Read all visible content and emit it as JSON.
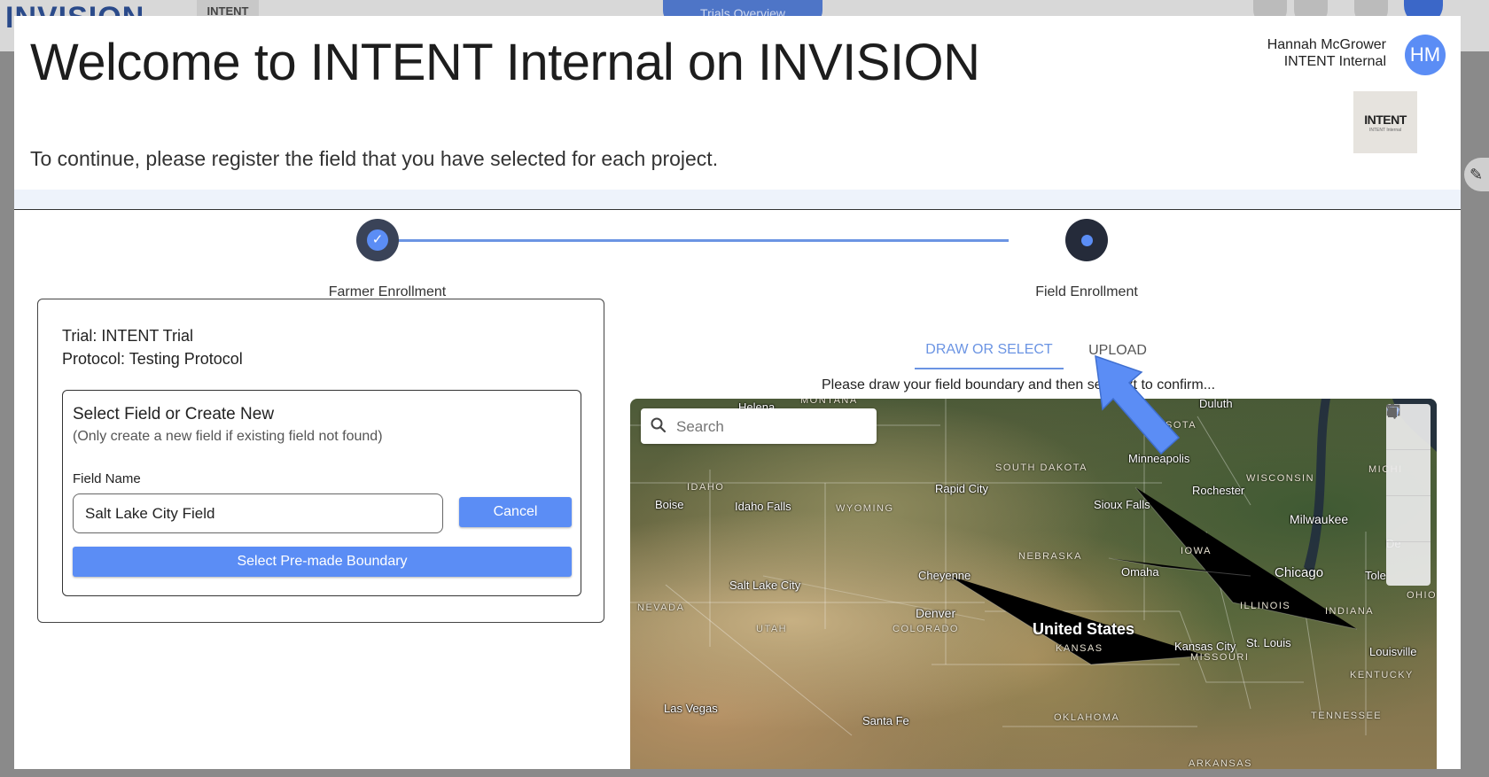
{
  "background": {
    "app_logo": "INVISION",
    "mini_tab": "INTENT",
    "pill": "Trials Overview"
  },
  "modal": {
    "title": "Welcome to INTENT Internal on INVISION",
    "subtitle": "To continue, please register the field that you have selected for each project.",
    "user": {
      "name": "Hannah McGrower",
      "org": "INTENT Internal",
      "initials": "HM"
    },
    "org_logo": {
      "name": "INTENT",
      "tagline": "INTENT Internal"
    }
  },
  "stepper": {
    "steps": [
      {
        "label": "Farmer Enrollment",
        "status": "complete"
      },
      {
        "label": "Field Enrollment",
        "status": "active"
      }
    ]
  },
  "enrollment": {
    "trial": "Trial: INTENT Trial",
    "protocol": "Protocol: Testing Protocol",
    "select_title": "Select Field or Create New",
    "select_hint": "(Only create a new field if existing field not found)",
    "field_name_label": "Field Name",
    "field_name_value": "Salt Lake City Field",
    "cancel_label": "Cancel",
    "premade_label": "Select Pre-made Boundary"
  },
  "map_panel": {
    "tabs": [
      {
        "label": "DRAW OR SELECT",
        "active": true
      },
      {
        "label": "UPLOAD",
        "active": false
      }
    ],
    "instruction": "Please draw your field boundary and then se",
    "instruction_tail": "ext to confirm...",
    "search_placeholder": "Search",
    "tools": [
      "pointer-icon",
      "rectangle-icon",
      "polygon-icon",
      "trash-icon"
    ],
    "labels": {
      "cities": [
        "Helena",
        "Duluth",
        "Minneapolis",
        "Boise",
        "Idaho Falls",
        "Rapid City",
        "Rochester",
        "Sioux Falls",
        "Milwaukee",
        "De",
        "Omaha",
        "Chicago",
        "Tole",
        "Salt Lake City",
        "Cheyenne",
        "Denver",
        "Kansas City",
        "St. Louis",
        "Louisville",
        "Las Vegas",
        "Santa Fe"
      ],
      "states": [
        "MONTANA",
        "SOTA",
        "SOUTH DAKOTA",
        "WISCONSIN",
        "MICHI",
        "IDAHO",
        "WYOMING",
        "IOWA",
        "NEBRASKA",
        "NEVADA",
        "UTAH",
        "COLORADO",
        "ILLINOIS",
        "INDIANA",
        "OHIO",
        "KANSAS",
        "MISSOURI",
        "KENTUCKY",
        "OKLAHOMA",
        "TENNESSEE",
        "ARKANSAS"
      ],
      "country": "United States"
    }
  },
  "colors": {
    "accent": "#5b8df5",
    "step_dark": "#3a4358",
    "tab_active": "#6b94e3",
    "arrow": "#5b8df5"
  }
}
